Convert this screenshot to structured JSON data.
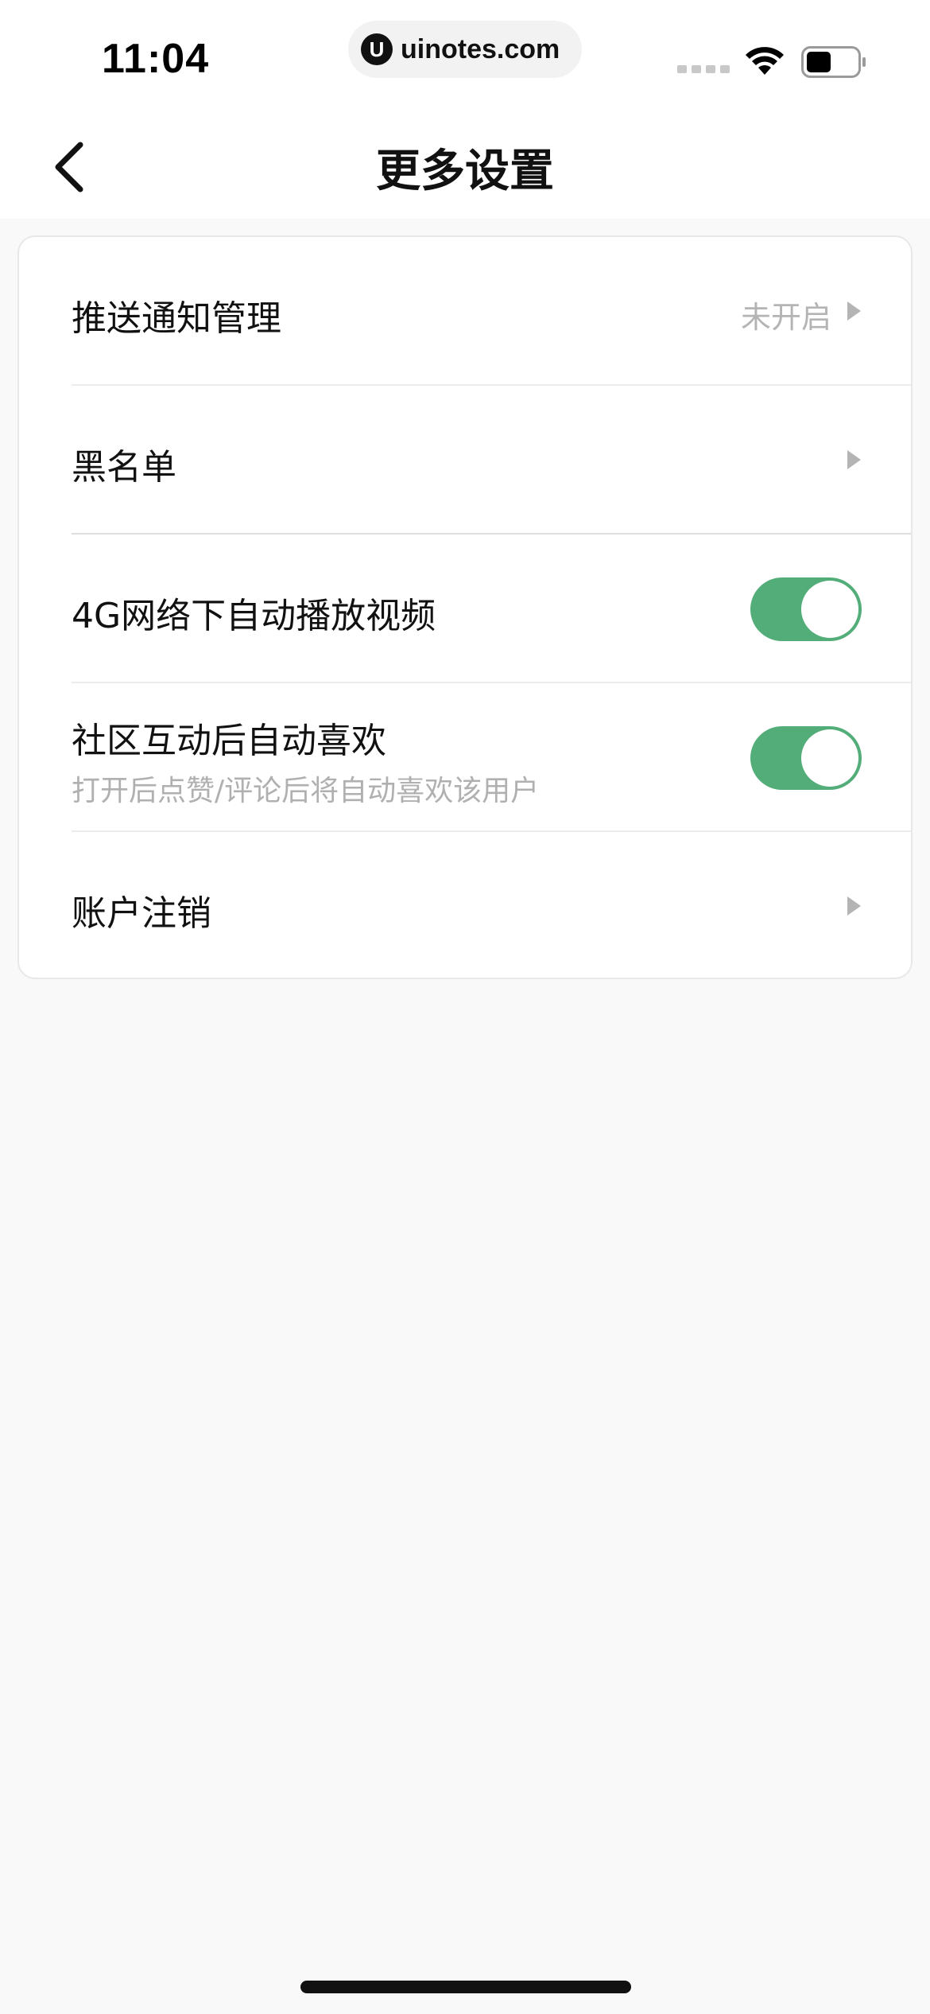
{
  "status_bar": {
    "time": "11:04",
    "url": "uinotes.com",
    "url_logo": "U",
    "icons": [
      "signal-icon",
      "wifi-icon",
      "battery-icon"
    ]
  },
  "nav": {
    "title": "更多设置",
    "back_icon": "chevron-left-icon"
  },
  "settings": {
    "push": {
      "label": "推送通知管理",
      "value": "未开启"
    },
    "blacklist": {
      "label": "黑名单"
    },
    "autoplay": {
      "label": "4G网络下自动播放视频",
      "enabled": true
    },
    "auto_like": {
      "label": "社区互动后自动喜欢",
      "subtitle": "打开后点赞/评论后将自动喜欢该用户",
      "enabled": true
    },
    "account_cancel": {
      "label": "账户注销"
    }
  },
  "colors": {
    "accent_green": "#52ad78",
    "background": "#f9f9f9",
    "card": "#ffffff",
    "secondary_text": "#b0b0b0"
  }
}
